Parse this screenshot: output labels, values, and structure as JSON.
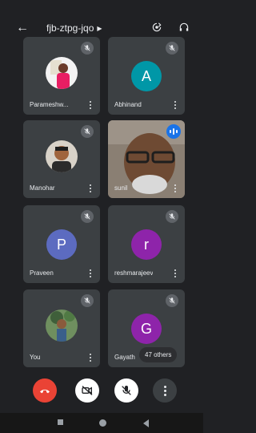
{
  "meeting": {
    "code": "fjb-ztpg-jqo",
    "others_count_label": "47 others"
  },
  "participants": [
    {
      "name": "Parameshw...",
      "kind": "photo",
      "muted": true
    },
    {
      "name": "Abhinand",
      "kind": "initial",
      "initial": "A",
      "color": "#0097a7",
      "muted": true
    },
    {
      "name": "Manohar",
      "kind": "photo",
      "muted": true
    },
    {
      "name": "sunil",
      "kind": "video",
      "muted": false,
      "speaking": true
    },
    {
      "name": "Praveen",
      "kind": "initial",
      "initial": "P",
      "color": "#5c6bc0",
      "muted": true
    },
    {
      "name": "reshmarajeev",
      "kind": "initial",
      "initial": "r",
      "color": "#8e24aa",
      "muted": true
    },
    {
      "name": "You",
      "kind": "photo",
      "muted": true
    },
    {
      "name": "Gayath",
      "kind": "initial",
      "initial": "G",
      "color": "#8e24aa",
      "muted": true
    }
  ],
  "colors": {
    "end_call": "#ea4335",
    "tile_bg": "#3c4043",
    "background": "#202124",
    "accent_blue": "#1a73e8"
  },
  "icons": {
    "back": "arrow-left-icon",
    "switch_camera": "camera-switch-icon",
    "audio": "headphones-icon",
    "mute": "mic-off-icon",
    "more": "more-vertical-icon",
    "end_call": "phone-hangup-icon",
    "video_off": "video-off-icon",
    "mic_off": "mic-off-icon"
  }
}
